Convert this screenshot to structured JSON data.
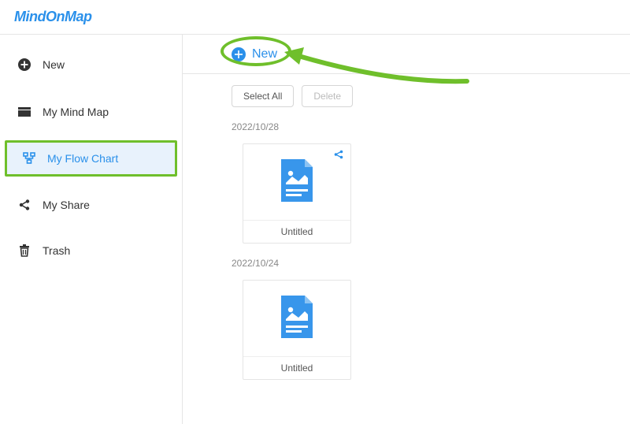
{
  "brand": "MindOnMap",
  "colors": {
    "accent": "#2a90ea",
    "highlight": "#6fbf2b"
  },
  "sidebar": {
    "items": [
      {
        "label": "New",
        "icon": "plus-circle-icon"
      },
      {
        "label": "My Mind Map",
        "icon": "folder-icon"
      },
      {
        "label": "My Flow Chart",
        "icon": "flowchart-icon",
        "active": true
      },
      {
        "label": "My Share",
        "icon": "share-icon"
      },
      {
        "label": "Trash",
        "icon": "trash-icon"
      }
    ]
  },
  "main": {
    "new_label": "New",
    "select_all_label": "Select All",
    "delete_label": "Delete",
    "groups": [
      {
        "date": "2022/10/28",
        "items": [
          {
            "title": "Untitled"
          }
        ]
      },
      {
        "date": "2022/10/24",
        "items": [
          {
            "title": "Untitled"
          }
        ]
      }
    ]
  }
}
